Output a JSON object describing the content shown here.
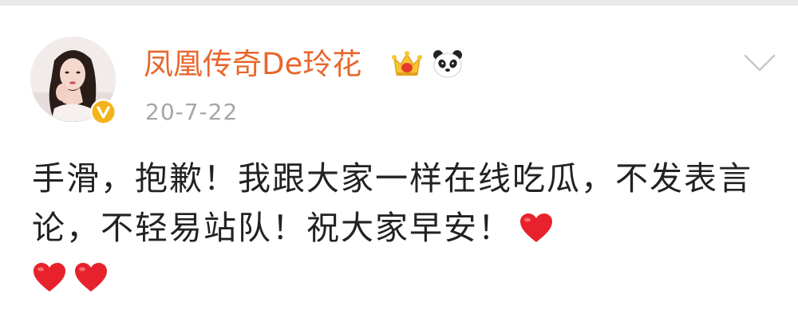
{
  "post": {
    "user_name": "凤凰传奇De玲花",
    "time": "20-7-22",
    "text": "手滑，抱歉！我跟大家一样在线吃瓜，不发表言论，不轻易站队！祝大家早安！",
    "emojis": [
      "heart-emoji",
      "heart-emoji",
      "heart-emoji"
    ]
  },
  "badges": {
    "verified": "verified-icon",
    "vip": "crown-icon",
    "fan": "panda-icon"
  },
  "actions": {
    "more": "chevron-down-icon"
  },
  "colors": {
    "name": "#e8672c",
    "time": "#a6a6a6",
    "text": "#222222",
    "verified": "#f5b31b",
    "heart": "#e8222c"
  }
}
